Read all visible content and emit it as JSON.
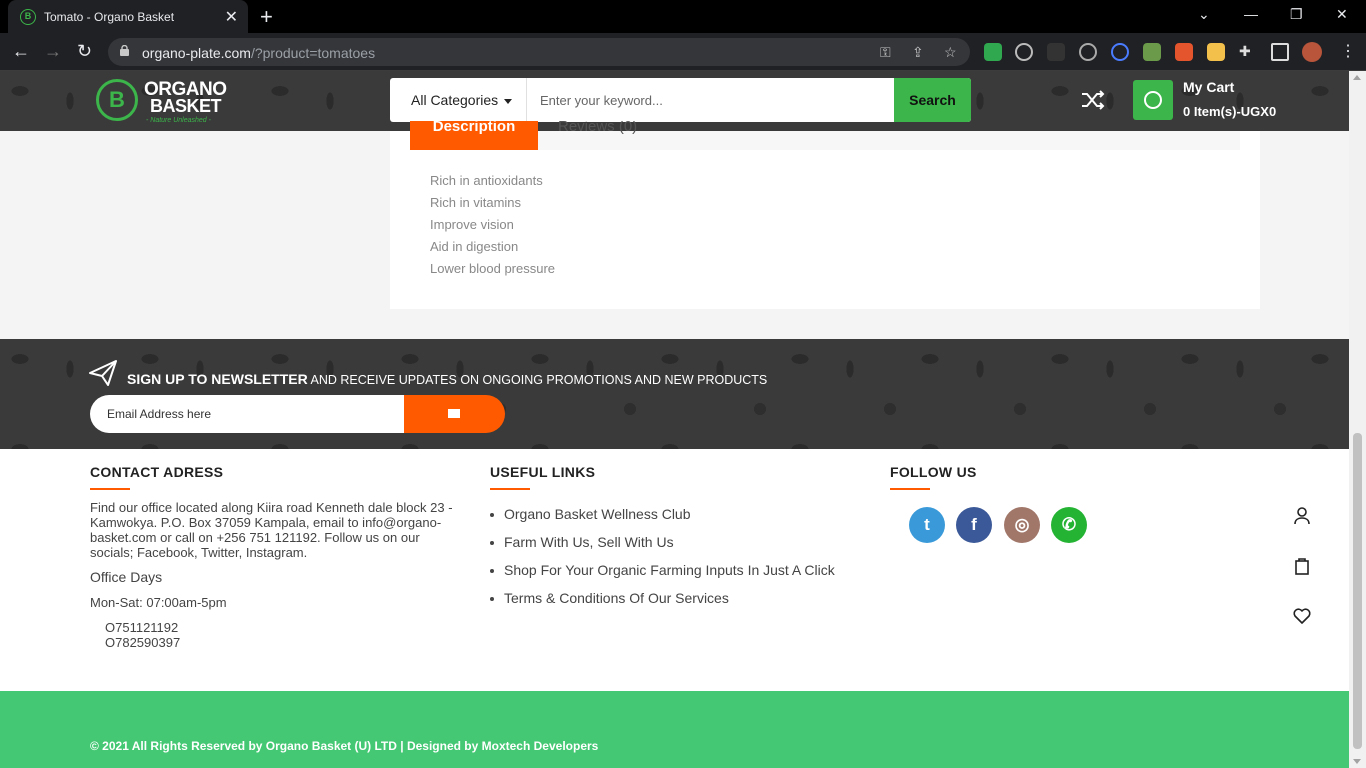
{
  "browser": {
    "tab_title": "Tomato - Organo Basket",
    "url_host": "organo-plate.com",
    "url_path": "/?product=tomatoes"
  },
  "header": {
    "logo_line1": "ORGANO",
    "logo_line2": "BASKET",
    "logo_tagline": "- Nature Unleashed -",
    "category_label": "All Categories",
    "search_placeholder": "Enter your keyword...",
    "search_button": "Search",
    "cart_title": "My Cart",
    "cart_summary": "0 Item(s)-UGX0"
  },
  "product_tabs": {
    "description_label": "Description",
    "reviews_label": "Reviews (0)"
  },
  "benefits": [
    "Rich in antioxidants",
    "Rich in vitamins",
    "Improve vision",
    "Aid in digestion",
    "Lower blood pressure"
  ],
  "newsletter": {
    "title_bold": "SIGN UP TO NEWSLETTER",
    "title_rest": " AND RECEIVE UPDATES ON ONGOING PROMOTIONS AND NEW PRODUCTS",
    "email_placeholder": "Email Address here"
  },
  "footer": {
    "contact_heading": "CONTACT ADRESS",
    "address": "Find our office located along Kiira road Kenneth dale block 23 - Kamwokya. P.O. Box 37059 Kampala, email to info@organo-basket.com or call on +256 751 121192. Follow us on our socials; Facebook, Twitter, Instagram.",
    "office_days": "Office Days",
    "office_hours": "Mon-Sat: 07:00am-5pm",
    "phone1": "O751121192",
    "phone2": "O782590397",
    "links_heading": "USEFUL LINKS",
    "links": [
      "Organo Basket Wellness Club",
      "Farm With Us, Sell With Us",
      "Shop For Your Organic Farming Inputs In Just A Click",
      "Terms & Conditions Of Our Services"
    ],
    "follow_heading": "FOLLOW US",
    "copyright": "© 2021 All Rights Reserved by Organo Basket (U) LTD | Designed by Moxtech Developers"
  },
  "colors": {
    "brand_green": "#3cb54a",
    "accent_orange": "#ff5a00",
    "footer_green": "#44c873",
    "twitter": "#3a9ad9",
    "facebook": "#3b5998",
    "instagram": "#a1776a",
    "whatsapp": "#25b334"
  }
}
